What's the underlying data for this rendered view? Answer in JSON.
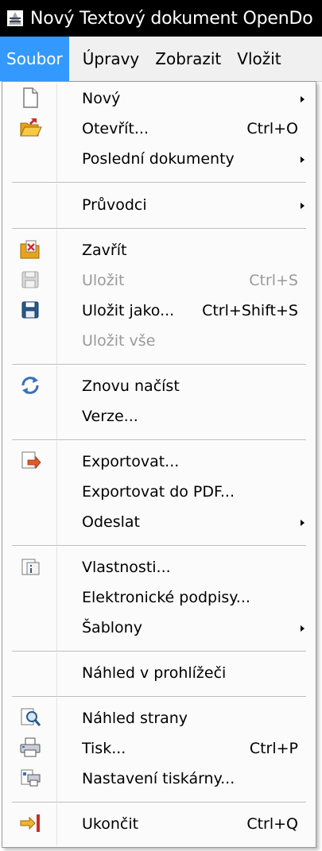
{
  "window": {
    "title": "Nový Textový dokument OpenDo",
    "icon": "openoffice-writer-icon"
  },
  "menubar": {
    "items": [
      {
        "label": "Soubor",
        "active": true
      },
      {
        "label": "Úpravy"
      },
      {
        "label": "Zobrazit"
      },
      {
        "label": "Vložit"
      }
    ]
  },
  "file_menu": {
    "items": [
      {
        "label": "Nový",
        "icon": "new-document-icon",
        "submenu": true
      },
      {
        "label": "Otevřít...",
        "icon": "open-folder-icon",
        "shortcut": "Ctrl+O"
      },
      {
        "label": "Poslední dokumenty",
        "submenu": true
      },
      {
        "label": "Průvodci",
        "submenu": true
      },
      {
        "label": "Zavřít",
        "icon": "close-document-icon"
      },
      {
        "label": "Uložit",
        "icon": "save-disk-icon",
        "shortcut": "Ctrl+S",
        "disabled": true
      },
      {
        "label": "Uložit jako...",
        "icon": "save-as-disk-icon",
        "shortcut": "Ctrl+Shift+S"
      },
      {
        "label": "Uložit vše",
        "disabled": true
      },
      {
        "label": "Znovu načíst",
        "icon": "reload-icon"
      },
      {
        "label": "Verze..."
      },
      {
        "label": "Exportovat...",
        "icon": "export-icon"
      },
      {
        "label": "Exportovat do PDF..."
      },
      {
        "label": "Odeslat",
        "submenu": true
      },
      {
        "label": "Vlastnosti...",
        "icon": "properties-icon"
      },
      {
        "label": "Elektronické podpisy..."
      },
      {
        "label": "Šablony",
        "submenu": true
      },
      {
        "label": "Náhled v prohlížeči"
      },
      {
        "label": "Náhled strany",
        "icon": "page-preview-icon"
      },
      {
        "label": "Tisk...",
        "icon": "printer-icon",
        "shortcut": "Ctrl+P"
      },
      {
        "label": "Nastavení tiskárny...",
        "icon": "printer-settings-icon"
      },
      {
        "label": "Ukončit",
        "icon": "exit-icon",
        "shortcut": "Ctrl+Q"
      }
    ]
  },
  "colors": {
    "title_bar": "#000000",
    "menu_highlight": "#3399ff",
    "disabled_text": "#9a9a9a"
  }
}
